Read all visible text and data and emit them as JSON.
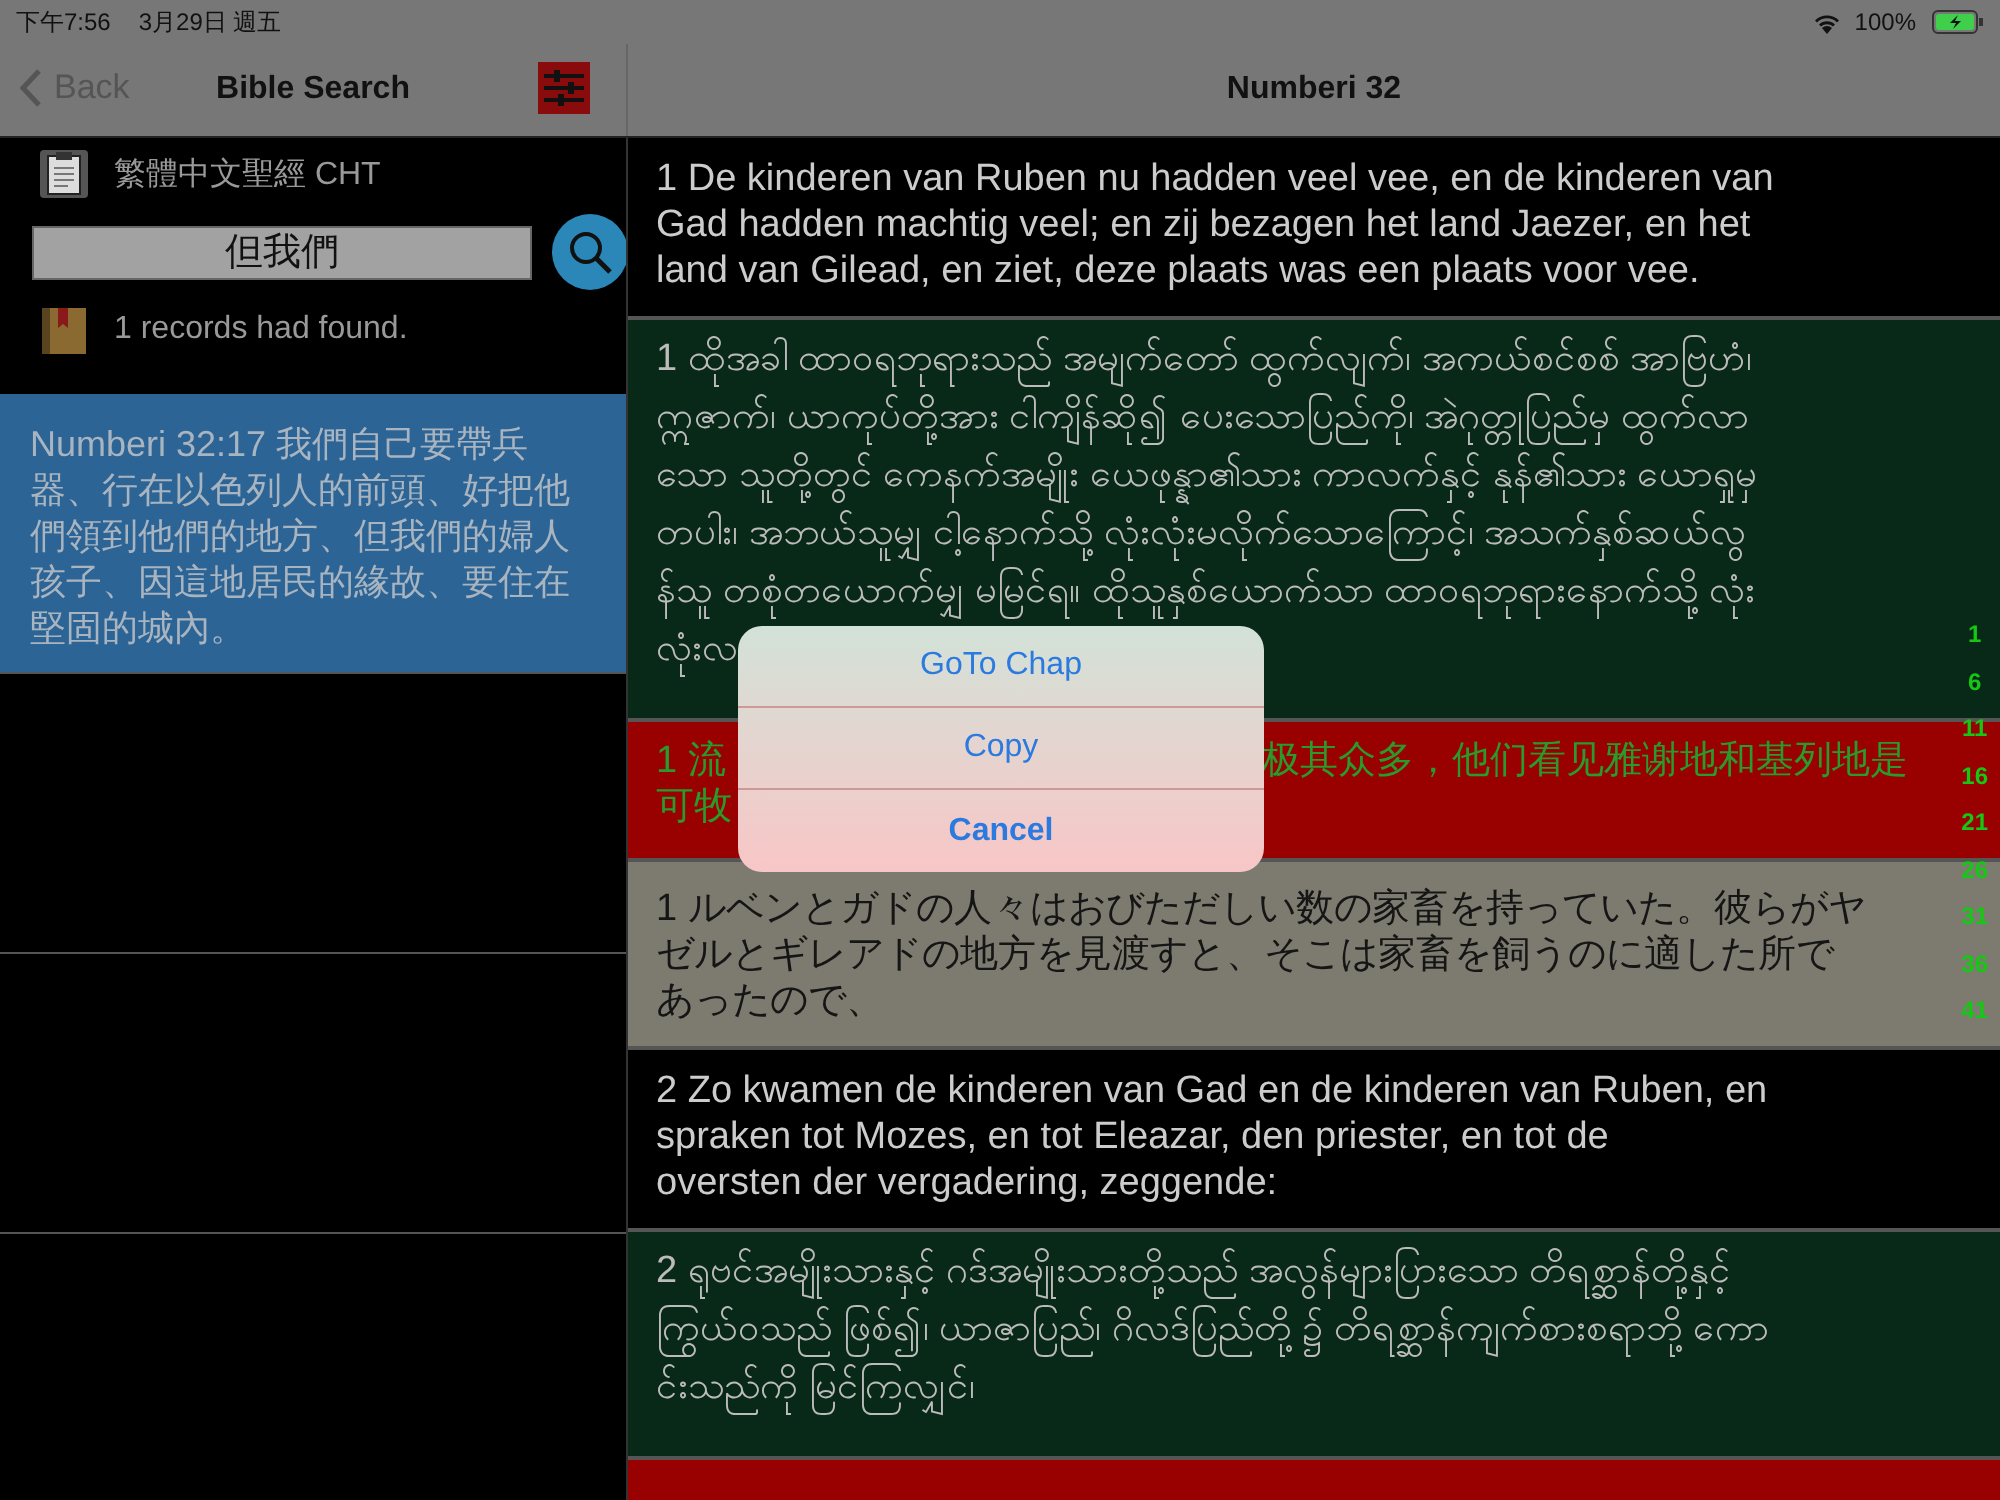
{
  "status_bar": {
    "time": "下午7:56",
    "date": "3月29日 週五",
    "battery": "100%"
  },
  "nav": {
    "back": "Back",
    "title": "Bible Search",
    "detail_title": "Numberi 32"
  },
  "search": {
    "bible": "繁體中文聖經 CHT",
    "value": "但我們",
    "records": "1 records had found."
  },
  "results": [
    {
      "text": "Numberi 32:17 我們自己要帶兵器、行在以色列人的前頭、好把他們領到他們的地方、但我們的婦人孩子、因這地居民的緣故、要住在堅固的城內。",
      "selected": true
    }
  ],
  "verses": [
    {
      "kind": "plain",
      "lines": [
        "1 De kinderen van Ruben nu hadden veel vee, en de kinderen van",
        "Gad hadden machtig veel; en zij bezagen het land Jaezer, en het",
        "land van Gilead, en ziet, deze plaats was een plaats voor vee."
      ]
    },
    {
      "kind": "green",
      "lines": [
        "1 ထိုအခါ ထာဝရဘုရားသည် အမျက်တော် ထွက်လျက်၊ အကယ်စင်စစ် အာဗြဟံ၊",
        "ဣဇာက်၊ ယာကုပ်တို့အား ငါကျိန်ဆို၍ ပေးသောပြည်ကို၊ အဲဂုတ္တုပြည်မှ ထွက်လာ",
        "သော သူတို့တွင် ကေနက်အမျိုး ယေဖုန္နာ၏သား ကာလက်နှင့် နုန်၏သား ယောရှုမှ",
        "တပါး၊ အဘယ်သူမျှ ငါ့နောက်သို့ လုံးလုံးမလိုက်သောကြောင့်၊ အသက်နှစ်ဆယ်လွ",
        "န်သူ တစုံတယောက်မျှ မမြင်ရ။ ထိုသူနှစ်ယောက်သာ ထာဝရဘုရားနောက်သို့ လုံး",
        "လုံးလ"
      ]
    },
    {
      "kind": "red",
      "lines": [
        "1 流",
        "可牧"
      ],
      "right_lines": [
        "极其众多，他们看见雅谢地和基列地是"
      ]
    },
    {
      "kind": "gray",
      "lines": [
        "1 ルベンとガドの人々はおびただしい数の家畜を持っていた。彼らがヤ",
        "ゼルとギレアドの地方を見渡すと、そこは家畜を飼うのに適した所で",
        "あったので、"
      ]
    },
    {
      "kind": "plain",
      "lines": [
        "2 Zo kwamen de kinderen van Gad en de kinderen van Ruben, en",
        "spraken tot Mozes, en tot Eleazar, den priester, en tot de",
        "oversten der vergadering, zeggende:"
      ]
    },
    {
      "kind": "green",
      "lines": [
        "2 ရုဗင်အမျိုးသားနှင့် ဂဒ်အမျိုးသားတို့သည် အလွန်များပြားသော တိရစ္ဆာန်တို့နှင့်",
        "ကြွယ်ဝသည် ဖြစ်၍၊ ယာဇာပြည်၊ ဂိလဒ်ပြည်တို့၌ တိရစ္ဆာန်ကျက်စားစရာဘို့ ကော",
        "င်းသည်ကို မြင်ကြလျှင်၊"
      ]
    }
  ],
  "verse_index": [
    "1",
    "6",
    "11",
    "16",
    "21",
    "26",
    "31",
    "36",
    "41"
  ],
  "alert": {
    "actions": [
      {
        "label": "GoTo Chap",
        "kind": "default"
      },
      {
        "label": "Copy",
        "kind": "default"
      },
      {
        "label": "Cancel",
        "kind": "cancel"
      }
    ]
  }
}
